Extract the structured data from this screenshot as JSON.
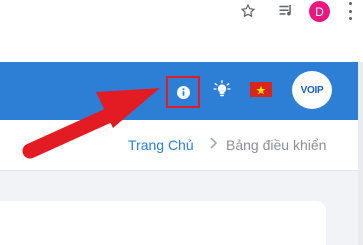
{
  "browser": {
    "avatar_letter": "D",
    "icons": [
      "star-icon",
      "media-queue-icon",
      "profile-avatar",
      "more-vert-icon"
    ],
    "avatar_color": "#e8187f"
  },
  "header": {
    "background": "#2d7fd6",
    "icons": [
      "info-icon",
      "lightbulb-icon",
      "vietnam-flag-icon",
      "voip-logo"
    ],
    "highlight_color": "#e31b23",
    "logo_text": "VOIP"
  },
  "breadcrumb": {
    "home": "Trang Chủ",
    "current": "Bảng điều khiển"
  },
  "annotation": {
    "arrow_color": "#e31b23"
  }
}
